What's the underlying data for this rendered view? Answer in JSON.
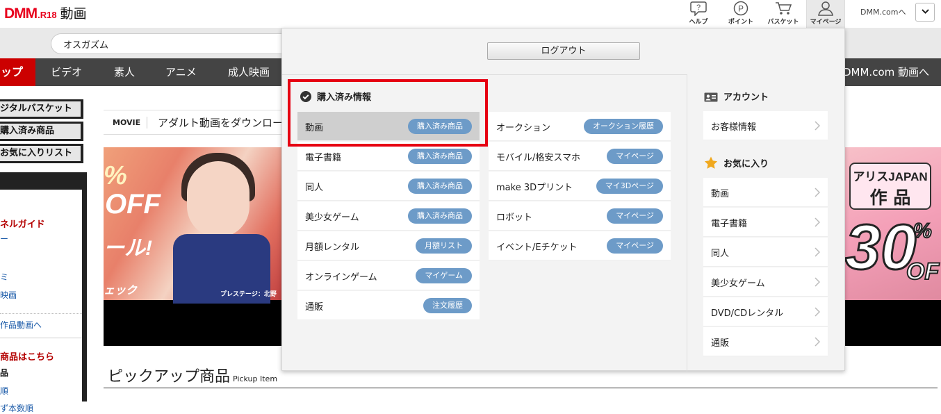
{
  "header": {
    "logo": {
      "brand": "DMM",
      "suffix": ".R18",
      "section": "動画"
    },
    "icons": [
      {
        "id": "help",
        "label": "ヘルプ"
      },
      {
        "id": "point",
        "label": "ポイント"
      },
      {
        "id": "basket",
        "label": "バスケット"
      },
      {
        "id": "mypage",
        "label": "マイページ"
      }
    ],
    "dmm_link": "DMM.comへ"
  },
  "search": {
    "value": "オスガズム"
  },
  "nav": {
    "top": "ップ",
    "items": [
      "ビデオ",
      "素人",
      "アニメ",
      "成人映画"
    ],
    "dmm_link": "DMM.com 動画へ"
  },
  "sidebar": {
    "buttons": [
      "ジタルバスケット",
      "購入済み商品",
      "お気に入りリスト"
    ],
    "guide_title": "ネルガイド",
    "guide_links": [
      "ー",
      "",
      "ミ",
      "映画"
    ],
    "works_link": "作品動画へ",
    "products_title": "商品はこちら",
    "products_items": [
      "品",
      "順",
      "ず本数順"
    ]
  },
  "main": {
    "movie_label": "MOVIE",
    "movie_text": "アダルト動画をダウンロー",
    "banner_left": {
      "pct": "%",
      "off": "OFF",
      "sale": "ール!",
      "check": "ェック",
      "caption": "プレステージ：北野"
    },
    "banner_right": {
      "line1": "アリスJAPAN",
      "line2": "作 品",
      "big": "30",
      "pct": "%",
      "off": "OF"
    },
    "pickup_title": "ピックアップ商品",
    "pickup_sub": "Pickup Item"
  },
  "panel": {
    "logout": "ログアウト",
    "purchased_title": "購入済み情報",
    "col1": [
      {
        "label": "動画",
        "action": "購入済み商品"
      },
      {
        "label": "電子書籍",
        "action": "購入済み商品"
      },
      {
        "label": "同人",
        "action": "購入済み商品"
      },
      {
        "label": "美少女ゲーム",
        "action": "購入済み商品"
      },
      {
        "label": "月額レンタル",
        "action": "月額リスト"
      },
      {
        "label": "オンラインゲーム",
        "action": "マイゲーム"
      },
      {
        "label": "通販",
        "action": "注文履歴"
      }
    ],
    "col2": [
      {
        "label": "オークション",
        "action": "オークション履歴"
      },
      {
        "label": "モバイル/格安スマホ",
        "action": "マイページ"
      },
      {
        "label": "make 3Dプリント",
        "action": "マイ3Dページ"
      },
      {
        "label": "ロボット",
        "action": "マイページ"
      },
      {
        "label": "イベント/Eチケット",
        "action": "マイページ"
      }
    ],
    "account_title": "アカウント",
    "account_items": [
      "お客様情報"
    ],
    "favorites_title": "お気に入り",
    "favorites_items": [
      "動画",
      "電子書籍",
      "同人",
      "美少女ゲーム",
      "DVD/CDレンタル",
      "通販"
    ]
  },
  "colors": {
    "accent_red": "#cc0000",
    "pill_blue": "#6d9bc8",
    "highlight": "#e60012"
  }
}
